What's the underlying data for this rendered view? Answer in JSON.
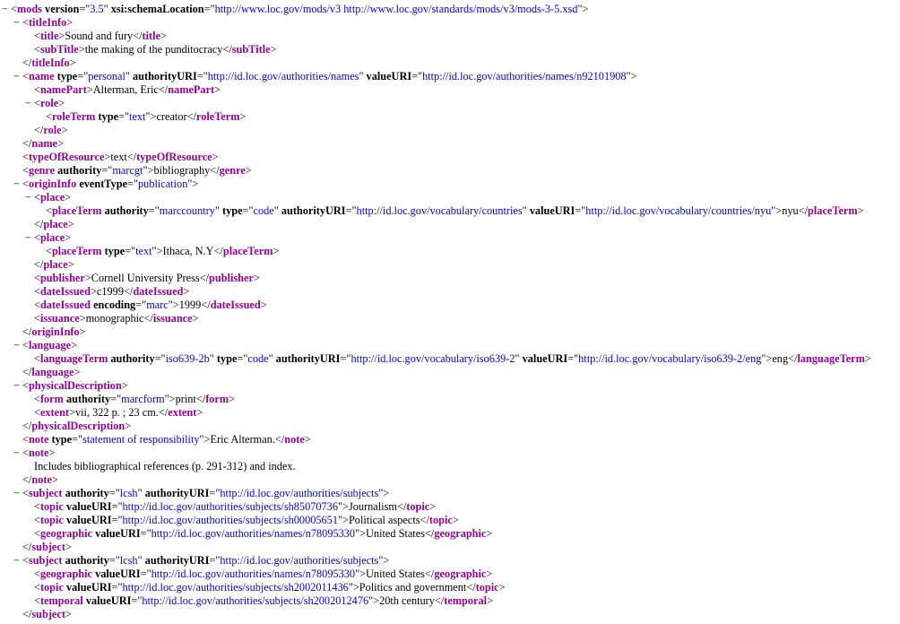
{
  "toggle_symbol": "−",
  "lines": [
    {
      "d": 0,
      "t": 1,
      "k": "o",
      "n": "mods",
      "a": [
        [
          "version",
          "3.5"
        ],
        [
          "xsi:schemaLocation",
          "http://www.loc.gov/mods/v3 http://www.loc.gov/standards/mods/v3/mods-3-5.xsd"
        ]
      ]
    },
    {
      "d": 1,
      "t": 1,
      "k": "o",
      "n": "titleInfo"
    },
    {
      "d": 2,
      "k": "e",
      "n": "title",
      "x": "Sound and fury"
    },
    {
      "d": 2,
      "k": "e",
      "n": "subTitle",
      "x": "the making of the punditocracy"
    },
    {
      "d": 1,
      "k": "c",
      "n": "titleInfo"
    },
    {
      "d": 1,
      "t": 1,
      "k": "o",
      "n": "name",
      "a": [
        [
          "type",
          "personal"
        ],
        [
          "authorityURI",
          "http://id.loc.gov/authorities/names"
        ],
        [
          "valueURI",
          "http://id.loc.gov/authorities/names/n92101908"
        ]
      ]
    },
    {
      "d": 2,
      "k": "e",
      "n": "namePart",
      "x": "Alterman, Eric"
    },
    {
      "d": 2,
      "t": 1,
      "k": "o",
      "n": "role"
    },
    {
      "d": 3,
      "k": "e",
      "n": "roleTerm",
      "a": [
        [
          "type",
          "text"
        ]
      ],
      "x": "creator"
    },
    {
      "d": 2,
      "k": "c",
      "n": "role"
    },
    {
      "d": 1,
      "k": "c",
      "n": "name"
    },
    {
      "d": 1,
      "k": "e",
      "n": "typeOfResource",
      "x": "text"
    },
    {
      "d": 1,
      "k": "e",
      "n": "genre",
      "a": [
        [
          "authority",
          "marcgt"
        ]
      ],
      "x": "bibliography"
    },
    {
      "d": 1,
      "t": 1,
      "k": "o",
      "n": "originInfo",
      "a": [
        [
          "eventType",
          "publication"
        ]
      ]
    },
    {
      "d": 2,
      "t": 1,
      "k": "o",
      "n": "place"
    },
    {
      "d": 3,
      "k": "e",
      "n": "placeTerm",
      "a": [
        [
          "authority",
          "marccountry"
        ],
        [
          "type",
          "code"
        ],
        [
          "authorityURI",
          "http://id.loc.gov/vocabulary/countries"
        ],
        [
          "valueURI",
          "http://id.loc.gov/vocabulary/countries/nyu"
        ]
      ],
      "x": "nyu"
    },
    {
      "d": 2,
      "k": "c",
      "n": "place"
    },
    {
      "d": 2,
      "t": 1,
      "k": "o",
      "n": "place"
    },
    {
      "d": 3,
      "k": "e",
      "n": "placeTerm",
      "a": [
        [
          "type",
          "text"
        ]
      ],
      "x": "Ithaca, N.Y"
    },
    {
      "d": 2,
      "k": "c",
      "n": "place"
    },
    {
      "d": 2,
      "k": "e",
      "n": "publisher",
      "x": "Cornell University Press"
    },
    {
      "d": 2,
      "k": "e",
      "n": "dateIssued",
      "x": "c1999"
    },
    {
      "d": 2,
      "k": "e",
      "n": "dateIssued",
      "a": [
        [
          "encoding",
          "marc"
        ]
      ],
      "x": "1999"
    },
    {
      "d": 2,
      "k": "e",
      "n": "issuance",
      "x": "monographic"
    },
    {
      "d": 1,
      "k": "c",
      "n": "originInfo"
    },
    {
      "d": 1,
      "t": 1,
      "k": "o",
      "n": "language"
    },
    {
      "d": 2,
      "k": "e",
      "n": "languageTerm",
      "a": [
        [
          "authority",
          "iso639-2b"
        ],
        [
          "type",
          "code"
        ],
        [
          "authorityURI",
          "http://id.loc.gov/vocabulary/iso639-2"
        ],
        [
          "valueURI",
          "http://id.loc.gov/vocabulary/iso639-2/eng"
        ]
      ],
      "x": "eng"
    },
    {
      "d": 1,
      "k": "c",
      "n": "language"
    },
    {
      "d": 1,
      "t": 1,
      "k": "o",
      "n": "physicalDescription"
    },
    {
      "d": 2,
      "k": "e",
      "n": "form",
      "a": [
        [
          "authority",
          "marcform"
        ]
      ],
      "x": "print"
    },
    {
      "d": 2,
      "k": "e",
      "n": "extent",
      "x": "vii, 322 p. ; 23 cm."
    },
    {
      "d": 1,
      "k": "c",
      "n": "physicalDescription"
    },
    {
      "d": 1,
      "k": "e",
      "n": "note",
      "a": [
        [
          "type",
          "statement of responsibility"
        ]
      ],
      "x": "Eric Alterman."
    },
    {
      "d": 1,
      "t": 1,
      "k": "o",
      "n": "note"
    },
    {
      "d": 2,
      "k": "x",
      "x": "Includes bibliographical references (p. 291-312) and index."
    },
    {
      "d": 1,
      "k": "c",
      "n": "note"
    },
    {
      "d": 1,
      "t": 1,
      "k": "o",
      "n": "subject",
      "a": [
        [
          "authority",
          "lcsh"
        ],
        [
          "authorityURI",
          "http://id.loc.gov/authorities/subjects"
        ]
      ]
    },
    {
      "d": 2,
      "k": "e",
      "n": "topic",
      "a": [
        [
          "valueURI",
          "http://id.loc.gov/authorities/subjects/sh85070736"
        ]
      ],
      "x": "Journalism"
    },
    {
      "d": 2,
      "k": "e",
      "n": "topic",
      "a": [
        [
          "valueURI",
          "http://id.loc.gov/authorities/subjects/sh00005651"
        ]
      ],
      "x": "Political aspects"
    },
    {
      "d": 2,
      "k": "e",
      "n": "geographic",
      "a": [
        [
          "valueURI",
          "http://id.loc.gov/authorities/names/n78095330"
        ]
      ],
      "x": "United States"
    },
    {
      "d": 1,
      "k": "c",
      "n": "subject"
    },
    {
      "d": 1,
      "t": 1,
      "k": "o",
      "n": "subject",
      "a": [
        [
          "authority",
          "lcsh"
        ],
        [
          "authorityURI",
          "http://id.loc.gov/authorities/subjects"
        ]
      ]
    },
    {
      "d": 2,
      "k": "e",
      "n": "geographic",
      "a": [
        [
          "valueURI",
          "http://id.loc.gov/authorities/names/n78095330"
        ]
      ],
      "x": "United States"
    },
    {
      "d": 2,
      "k": "e",
      "n": "topic",
      "a": [
        [
          "valueURI",
          "http://id.loc.gov/authorities/subjects/sh2002011436"
        ]
      ],
      "x": "Politics and government"
    },
    {
      "d": 2,
      "k": "e",
      "n": "temporal",
      "a": [
        [
          "valueURI",
          "http://id.loc.gov/authorities/subjects/sh2002012476"
        ]
      ],
      "x": "20th century"
    },
    {
      "d": 1,
      "k": "c",
      "n": "subject"
    }
  ]
}
